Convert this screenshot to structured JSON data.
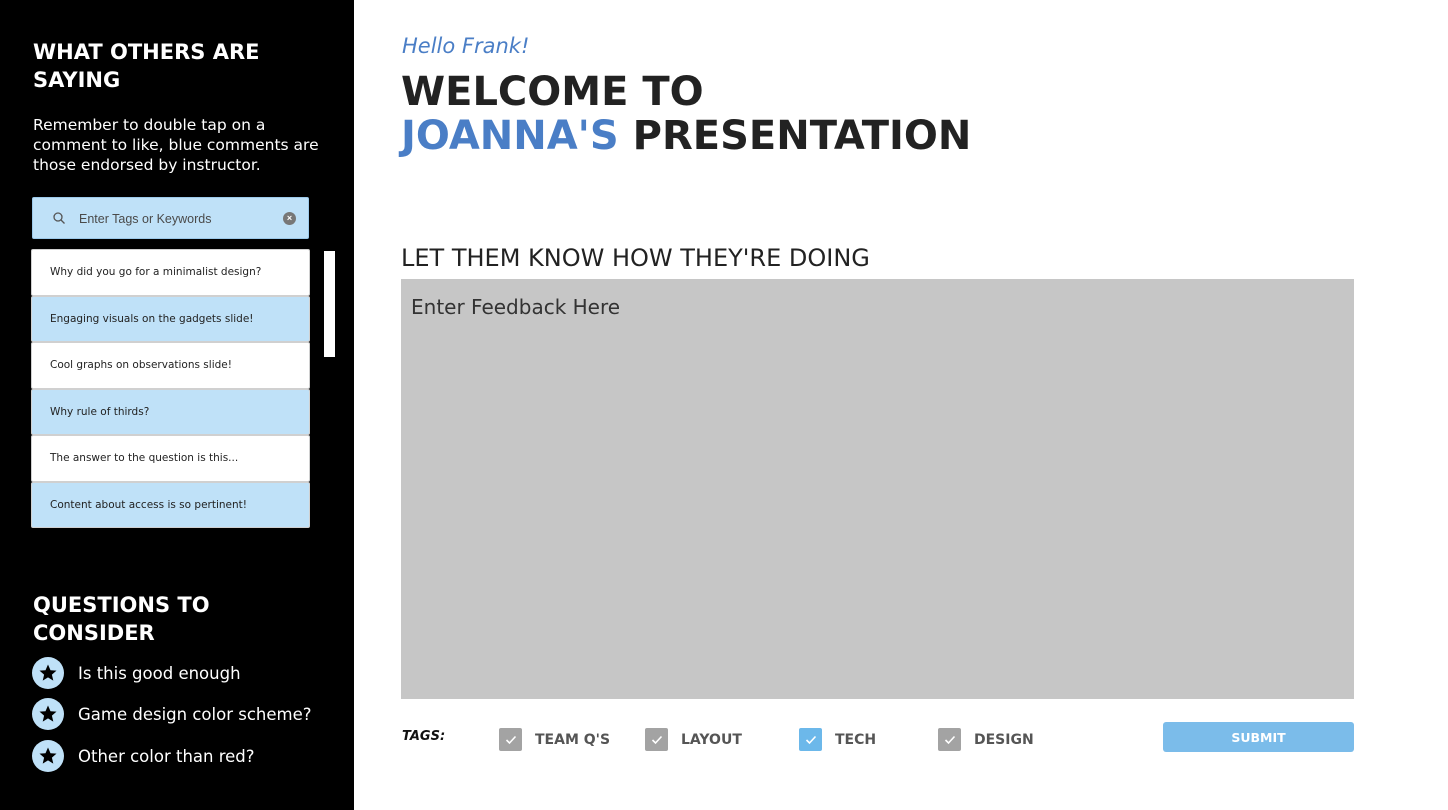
{
  "sidebar": {
    "title": "WHAT OTHERS ARE SAYING",
    "description": "Remember to double tap on a comment to like, blue comments are those endorsed by instructor.",
    "search": {
      "placeholder": "Enter Tags or Keywords",
      "value": ""
    },
    "comments": [
      {
        "text": "Why did you go for a minimalist design?",
        "endorsed": false
      },
      {
        "text": "Engaging visuals on the gadgets slide!",
        "endorsed": true
      },
      {
        "text": "Cool graphs on observations slide!",
        "endorsed": false
      },
      {
        "text": "Why rule of thirds?",
        "endorsed": true
      },
      {
        "text": "The answer to the question is this...",
        "endorsed": false
      },
      {
        "text": "Content about access is so pertinent!",
        "endorsed": true
      }
    ],
    "questions_title": "QUESTIONS TO CONSIDER",
    "questions": [
      {
        "icon": "star-icon",
        "text": "Is this good enough"
      },
      {
        "icon": "star-icon",
        "text": "Game design color scheme?"
      },
      {
        "icon": "star-icon",
        "text": "Other color than red?"
      }
    ]
  },
  "main": {
    "greeting": "Hello Frank!",
    "welcome_line1": "WELCOME TO",
    "presenter": "JOANNA'S",
    "welcome_line2_rest": " PRESENTATION",
    "feedback_title": "LET THEM KNOW HOW THEY'RE DOING",
    "feedback_placeholder": "Enter Feedback Here",
    "tags_label": "TAGS:",
    "tags": [
      {
        "label": "TEAM Q'S",
        "checked": true,
        "color": "#a3a3a3"
      },
      {
        "label": "LAYOUT",
        "checked": true,
        "color": "#a3a3a3"
      },
      {
        "label": "TECH",
        "checked": true,
        "color": "#6cb8ea"
      },
      {
        "label": "DESIGN",
        "checked": true,
        "color": "#a3a3a3"
      }
    ],
    "submit_label": "SUBMIT"
  },
  "colors": {
    "accent": "#4a7ec6",
    "endorsed_comment": "#bfe1f8",
    "submit": "#7bbcea",
    "feedback_box": "#c6c6c6"
  }
}
